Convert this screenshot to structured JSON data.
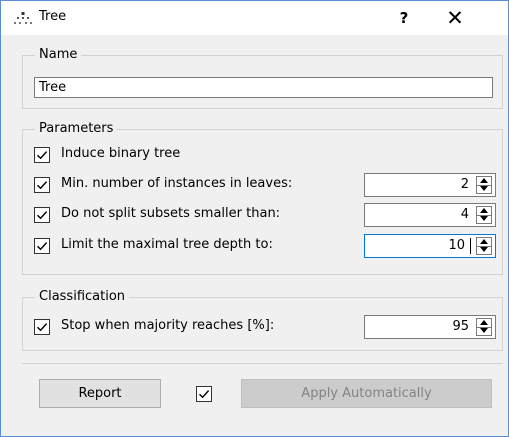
{
  "window": {
    "title": "Tree",
    "help_label": "?",
    "close_label": "✕"
  },
  "name_group": {
    "legend": "Name",
    "value": "Tree"
  },
  "parameters": {
    "legend": "Parameters",
    "items": [
      {
        "label": "Induce binary tree",
        "checked": true
      },
      {
        "label": "Min. number of instances in leaves:",
        "checked": true,
        "value": "2"
      },
      {
        "label": "Do not split subsets smaller than:",
        "checked": true,
        "value": "4"
      },
      {
        "label": "Limit the maximal tree depth to:",
        "checked": true,
        "value": "10"
      }
    ]
  },
  "classification": {
    "legend": "Classification",
    "label": "Stop when majority reaches [%]:",
    "checked": true,
    "value": "95"
  },
  "footer": {
    "report_label": "Report",
    "auto_apply_checked": true,
    "apply_label": "Apply Automatically"
  },
  "colors": {
    "window_border": "#5a8fd6",
    "focus_border": "#0078d7",
    "disabled_text": "#838383"
  }
}
